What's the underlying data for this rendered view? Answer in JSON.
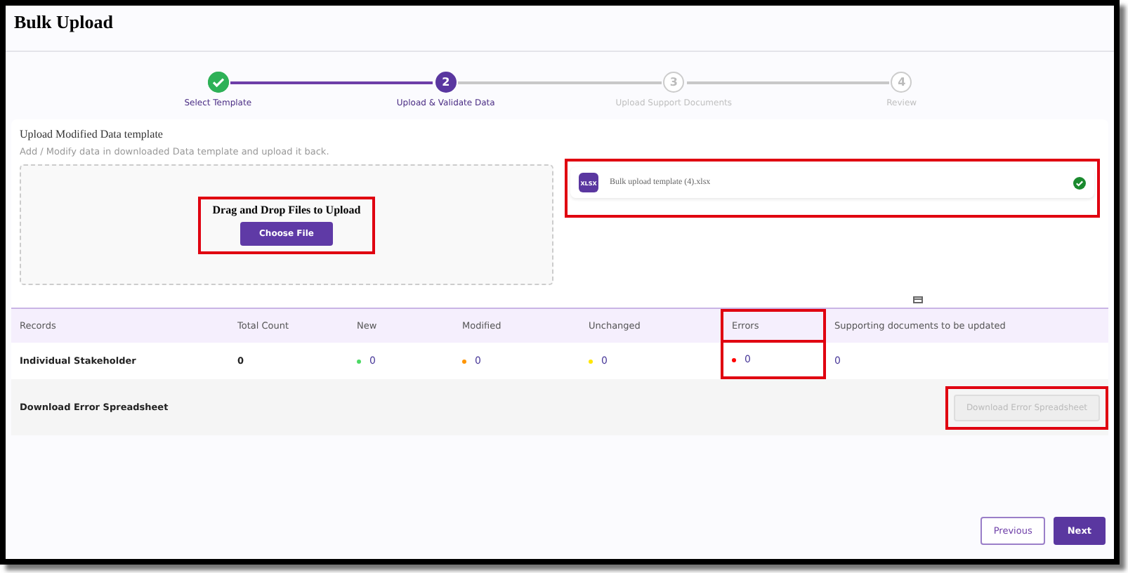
{
  "title": "Bulk Upload",
  "steps": [
    {
      "label": "Select Template",
      "kind": "done"
    },
    {
      "label": "Upload & Validate Data",
      "kind": "current",
      "number": "2"
    },
    {
      "label": "Upload Support Documents",
      "kind": "pending",
      "number": "3"
    },
    {
      "label": "Review",
      "kind": "pending",
      "number": "4"
    }
  ],
  "upload": {
    "title": "Upload Modified Data template",
    "subtitle": "Add / Modify data in downloaded Data template and upload it back.",
    "drop_text": "Drag and Drop Files to Upload",
    "button": "Choose File",
    "highlighted": true
  },
  "file": {
    "badge": "XLSX",
    "name": "Bulk upload template (4).xlsx",
    "validated": true,
    "highlighted": true
  },
  "table": {
    "columns": [
      {
        "label": "Records",
        "highlighted": false
      },
      {
        "label": "Total Count",
        "highlighted": false
      },
      {
        "label": "New",
        "highlighted": false
      },
      {
        "label": "Modified",
        "highlighted": false
      },
      {
        "label": "Unchanged",
        "highlighted": false
      },
      {
        "label": "Errors",
        "highlighted": true
      },
      {
        "label": "Supporting documents to be updated",
        "highlighted": false
      }
    ],
    "rows": [
      {
        "cells": [
          {
            "text": "Individual Stakeholder"
          },
          {
            "text": "0"
          },
          {
            "text": "0",
            "color": "#4cd964"
          },
          {
            "text": "0",
            "color": "#ff9500"
          },
          {
            "text": "0",
            "color": "#ffe600"
          },
          {
            "text": "0",
            "color": "#ff0000"
          },
          {
            "text": "0"
          }
        ]
      }
    ]
  },
  "download": {
    "label": "Download Error Spreadsheet",
    "button": "Download Error Spreadsheet",
    "disabled": true,
    "highlighted": true
  },
  "footer": {
    "previous": "Previous",
    "next": "Next"
  }
}
